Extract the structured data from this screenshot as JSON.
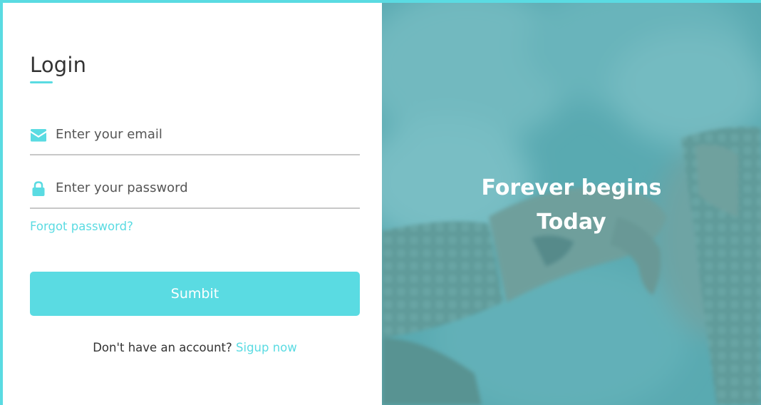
{
  "form": {
    "title": "Login",
    "email": {
      "icon": "envelope-icon",
      "placeholder": "Enter your email",
      "value": ""
    },
    "password": {
      "icon": "lock-icon",
      "placeholder": "Enter your password",
      "value": ""
    },
    "forgot_label": "Forgot password?",
    "submit_label": "Sumbit",
    "signup_prompt": "Don't have an account?",
    "signup_link": "Sigup now"
  },
  "hero": {
    "line1": "Forever begins",
    "line2": "Today",
    "image": "wedding-hands-photo"
  },
  "colors": {
    "accent": "#5adbe2",
    "text": "#333333",
    "overlay": "#5fa9b0"
  }
}
